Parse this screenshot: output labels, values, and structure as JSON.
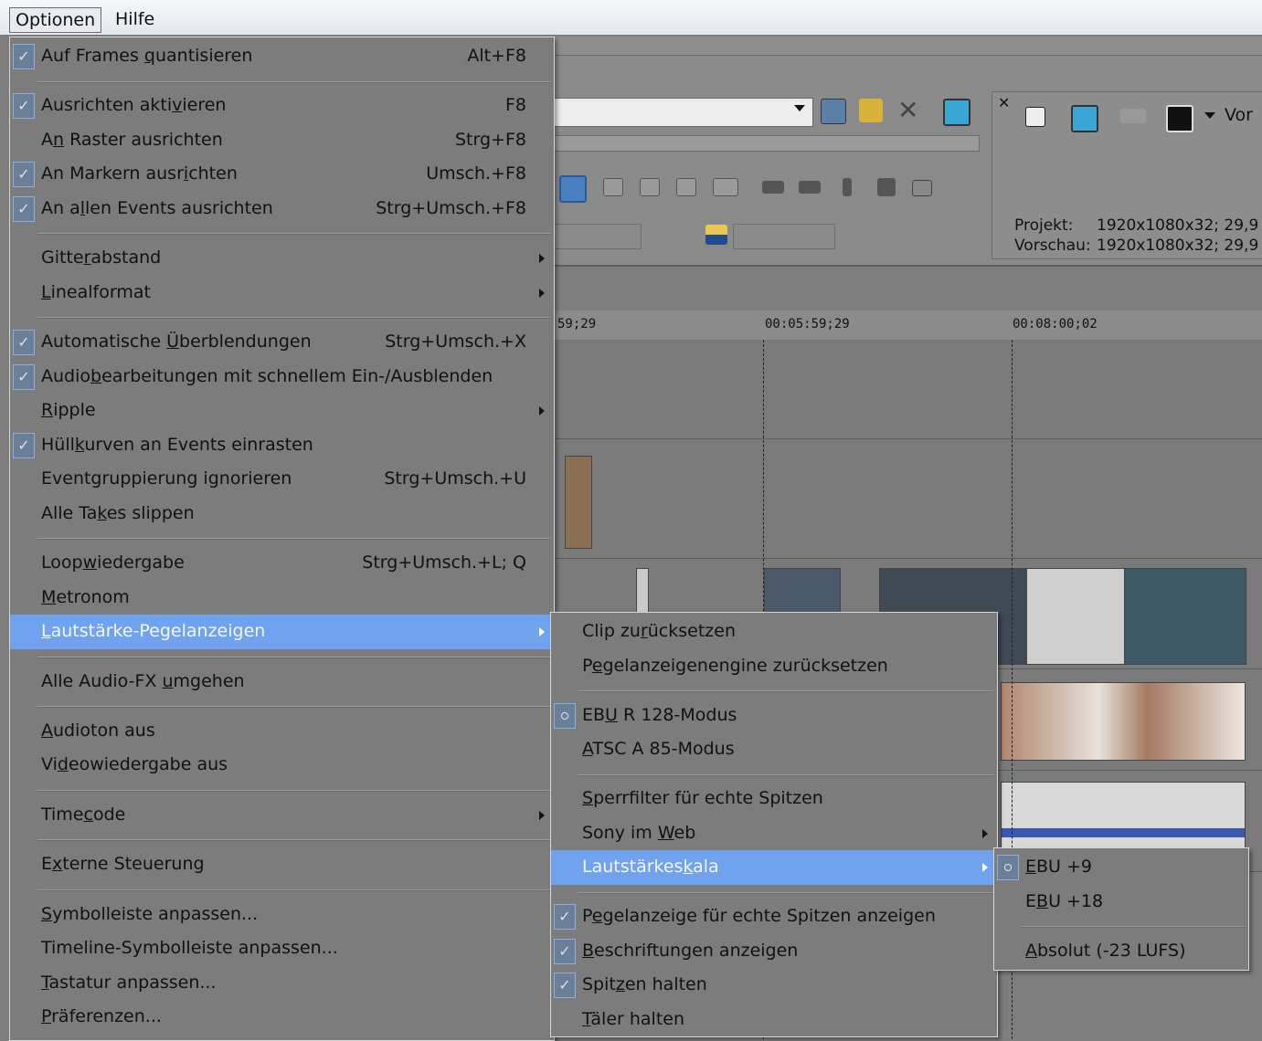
{
  "menubar": {
    "items": [
      "Optionen",
      "Hilfe"
    ]
  },
  "background": {
    "project_label": "Projekt:",
    "project_value": "1920x1080x32; 29,9",
    "preview_label": "Vorschau:",
    "preview_value": "1920x1080x32; 29,9",
    "toolbar_truncated": "Vor",
    "ruler": [
      "59;29",
      "00:05:59;29",
      "00:08:00;02"
    ]
  },
  "options_menu": [
    {
      "pre": "Auf Frames ",
      "u": "q",
      "post": "uantisieren",
      "shortcut": "Alt+F8",
      "state": "check"
    },
    {
      "sep": true
    },
    {
      "pre": "Ausrichten akti",
      "u": "v",
      "post": "ieren",
      "shortcut": "F8",
      "state": "check"
    },
    {
      "pre": "A",
      "u": "n",
      "post": " Raster ausrichten",
      "shortcut": "Strg+F8",
      "state": ""
    },
    {
      "pre": "An Markern ausr",
      "u": "i",
      "post": "chten",
      "shortcut": "Umsch.+F8",
      "state": "check"
    },
    {
      "pre": "An a",
      "u": "l",
      "post": "len Events ausrichten",
      "shortcut": "Strg+Umsch.+F8",
      "state": "check"
    },
    {
      "sep": true
    },
    {
      "pre": "Gitte",
      "u": "r",
      "post": "abstand",
      "shortcut": "",
      "state": "",
      "submenu": true
    },
    {
      "pre": "",
      "u": "L",
      "post": "inealformat",
      "shortcut": "",
      "state": "",
      "submenu": true
    },
    {
      "sep": true
    },
    {
      "pre": "Automatische ",
      "u": "Ü",
      "post": "berblendungen",
      "shortcut": "Strg+Umsch.+X",
      "state": "check"
    },
    {
      "pre": "Audio",
      "u": "b",
      "post": "earbeitungen mit schnellem Ein-/Ausblenden",
      "shortcut": "",
      "state": "check"
    },
    {
      "pre": "",
      "u": "R",
      "post": "ipple",
      "shortcut": "",
      "state": "",
      "submenu": true
    },
    {
      "pre": "Hüll",
      "u": "k",
      "post": "urven an Events einrasten",
      "shortcut": "",
      "state": "check"
    },
    {
      "pre": "Eventgruppierung i",
      "u": "g",
      "post": "norieren",
      "shortcut": "Strg+Umsch.+U",
      "state": ""
    },
    {
      "pre": "Alle Ta",
      "u": "k",
      "post": "es slippen",
      "shortcut": "",
      "state": ""
    },
    {
      "sep": true
    },
    {
      "pre": "Loop",
      "u": "w",
      "post": "iedergabe",
      "shortcut": "Strg+Umsch.+L; Q",
      "state": ""
    },
    {
      "pre": "",
      "u": "M",
      "post": "etronom",
      "shortcut": "",
      "state": ""
    },
    {
      "pre": "",
      "u": "L",
      "post": "autstärke-Pegelanzeigen",
      "shortcut": "",
      "state": "",
      "submenu": true,
      "highlight": true
    },
    {
      "sep": true
    },
    {
      "pre": "Alle Audio-FX ",
      "u": "u",
      "post": "mgehen",
      "shortcut": "",
      "state": ""
    },
    {
      "sep": true
    },
    {
      "pre": "",
      "u": "A",
      "post": "udioton aus",
      "shortcut": "",
      "state": ""
    },
    {
      "pre": "Vi",
      "u": "d",
      "post": "eowiedergabe aus",
      "shortcut": "",
      "state": ""
    },
    {
      "sep": true
    },
    {
      "pre": "Time",
      "u": "c",
      "post": "ode",
      "shortcut": "",
      "state": "",
      "submenu": true
    },
    {
      "sep": true
    },
    {
      "pre": "E",
      "u": "x",
      "post": "terne Steuerung",
      "shortcut": "",
      "state": ""
    },
    {
      "sep": true
    },
    {
      "pre": "",
      "u": "S",
      "post": "ymbolleiste anpassen...",
      "shortcut": "",
      "state": ""
    },
    {
      "pre": "Timeline-Symbolleiste anpassen...",
      "u": "",
      "post": "",
      "shortcut": "",
      "state": ""
    },
    {
      "pre": "",
      "u": "T",
      "post": "astatur anpassen...",
      "shortcut": "",
      "state": ""
    },
    {
      "pre": "",
      "u": "P",
      "post": "räferenzen...",
      "shortcut": "",
      "state": ""
    }
  ],
  "meter_menu": [
    {
      "pre": "Clip zu",
      "u": "r",
      "post": "ücksetzen",
      "state": ""
    },
    {
      "pre": "P",
      "u": "e",
      "post": "gelanzeigenengine zurücksetzen",
      "state": ""
    },
    {
      "sep": true
    },
    {
      "pre": "EB",
      "u": "U",
      "post": " R 128-Modus",
      "state": "radio"
    },
    {
      "pre": "",
      "u": "A",
      "post": "TSC A 85-Modus",
      "state": ""
    },
    {
      "sep": true
    },
    {
      "pre": "",
      "u": "S",
      "post": "perrfilter für echte Spitzen",
      "state": ""
    },
    {
      "pre": "Sony im ",
      "u": "W",
      "post": "eb",
      "state": "",
      "submenu": true
    },
    {
      "pre": "Lautstärkes",
      "u": "k",
      "post": "ala",
      "state": "",
      "submenu": true,
      "highlight": true
    },
    {
      "sep": true
    },
    {
      "pre": "P",
      "u": "e",
      "post": "gelanzeige für echte Spitzen anzeigen",
      "state": "check"
    },
    {
      "pre": "",
      "u": "B",
      "post": "eschriftungen anzeigen",
      "state": "check"
    },
    {
      "pre": "Spit",
      "u": "z",
      "post": "en halten",
      "state": "check"
    },
    {
      "pre": "",
      "u": "T",
      "post": "äler halten",
      "state": ""
    }
  ],
  "scale_menu": [
    {
      "pre": "",
      "u": "E",
      "post": "BU +9",
      "state": "radio"
    },
    {
      "pre": "E",
      "u": "B",
      "post": "U +18",
      "state": ""
    },
    {
      "sep": true
    },
    {
      "pre": "",
      "u": "A",
      "post": "bsolut (-23 LUFS)",
      "state": ""
    }
  ],
  "icons": [
    "check-icon",
    "radio-dot-icon",
    "submenu-arrow-icon",
    "dropdown-arrow-icon",
    "close-icon"
  ]
}
